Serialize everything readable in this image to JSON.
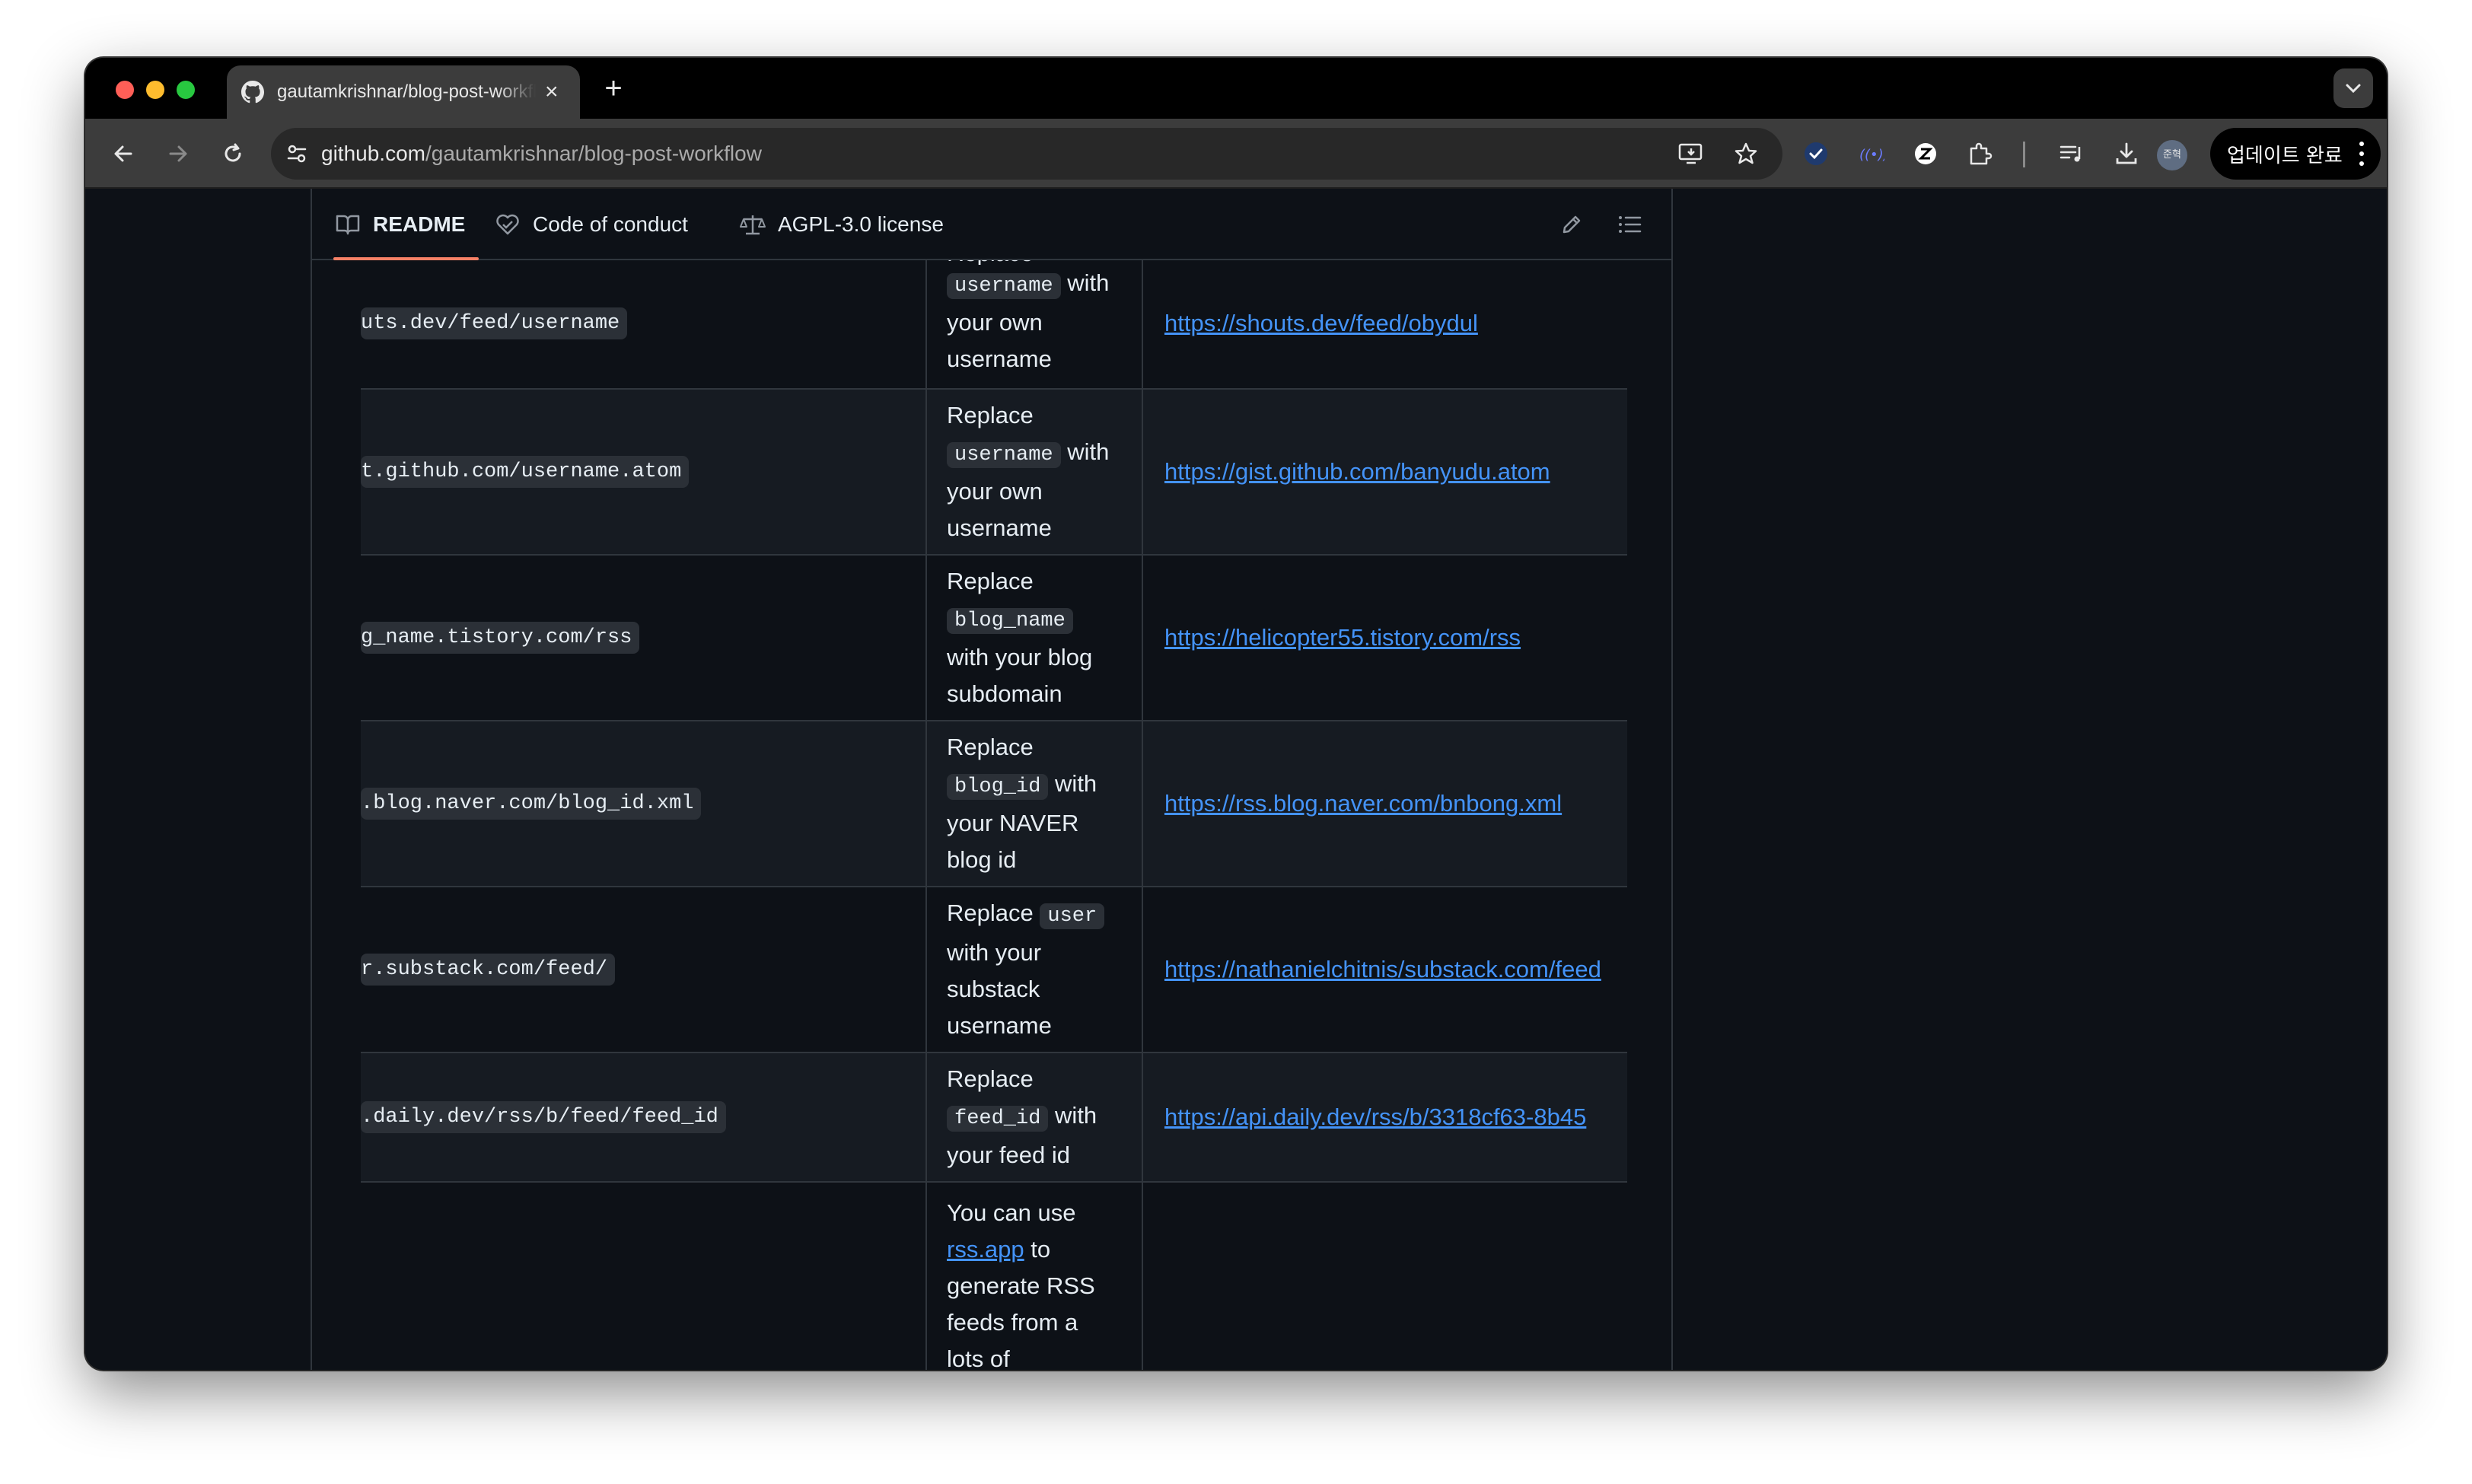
{
  "browser": {
    "tab_title": "gautamkrishnar/blog-post-workflow",
    "url_host": "github.com",
    "url_path": "/gautamkrishnar/blog-post-workflow",
    "profile_label": "준혁",
    "update_label": "업데이트 완료"
  },
  "readme": {
    "tabs": {
      "readme": "README",
      "code_of_conduct": "Code of conduct",
      "license": "AGPL-3.0 license"
    },
    "rows": [
      {
        "code": "uts.dev/feed/username",
        "desc": {
          "pre": "Replace",
          "code": "username",
          "post_inline": "with",
          "rest": [
            "your own",
            "username"
          ]
        },
        "example": "https://shouts.dev/feed/obydul"
      },
      {
        "code": "t.github.com/username.atom",
        "desc": {
          "pre": "Replace",
          "code": "username",
          "post_inline": "with",
          "rest": [
            "your own",
            "username"
          ]
        },
        "example": "https://gist.github.com/banyudu.atom"
      },
      {
        "code": "g_name.tistory.com/rss",
        "desc": {
          "pre": "Replace",
          "code": "blog_name",
          "post_inline": "",
          "rest": [
            "with your blog",
            "subdomain"
          ]
        },
        "example": "https://helicopter55.tistory.com/rss"
      },
      {
        "code": ".blog.naver.com/blog_id.xml",
        "desc": {
          "pre": "Replace",
          "code": "blog_id",
          "post_inline": "with",
          "rest": [
            "your NAVER",
            "blog id"
          ]
        },
        "example": "https://rss.blog.naver.com/bnbong.xml"
      },
      {
        "code": "r.substack.com/feed/",
        "desc": {
          "pre": "Replace",
          "code": "user",
          "post_inline": "",
          "rest": [
            "with your",
            "substack",
            "username"
          ]
        },
        "example": "https://nathanielchitnis/substack.com/feed"
      },
      {
        "code": ".daily.dev/rss/b/feed/feed_id",
        "desc": {
          "pre": "Replace",
          "code": "feed_id",
          "post_inline": "with",
          "rest": [
            "your feed id"
          ]
        },
        "example": "https://api.daily.dev/rss/b/3318cf63-8b45"
      }
    ],
    "last_row": {
      "line1": "You can use",
      "link": "rss.app",
      "after_link": "to",
      "rest": [
        "generate RSS",
        "feeds from a",
        "lots of"
      ]
    },
    "clipped_top_text": "Replace"
  }
}
